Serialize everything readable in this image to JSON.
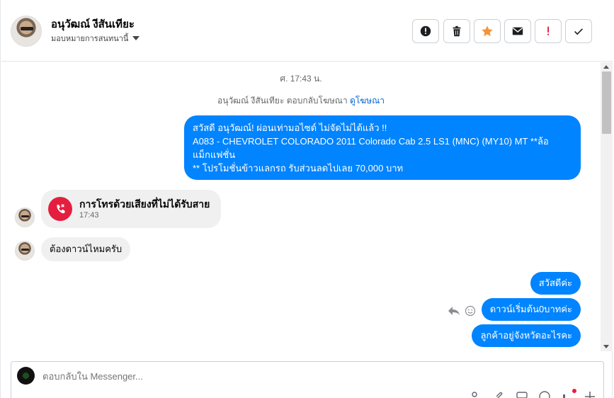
{
  "header": {
    "contact_name": "อนุวัฒณ์ งีสันเทียะ",
    "assign_label": "มอบหมายการสนทนานี้",
    "buttons": [
      {
        "name": "spam",
        "icon": "alert-circle-icon"
      },
      {
        "name": "delete",
        "icon": "trash-icon"
      },
      {
        "name": "star",
        "icon": "star-icon",
        "color": "#f7923a"
      },
      {
        "name": "mark-unread",
        "icon": "envelope-icon"
      },
      {
        "name": "important",
        "icon": "exclamation-icon",
        "color": "#e41e3f"
      },
      {
        "name": "done",
        "icon": "check-icon"
      }
    ]
  },
  "conversation": {
    "timestamp": "ศ. 17:43 น.",
    "reply_note_prefix": "อนุวัฒณ์ งีสันเทียะ ตอบกลับโฆษณา",
    "reply_note_link": "ดูโฆษณา",
    "ad_message": {
      "line1": "สวัสดี อนุวัฒณ์! ผ่อนเท่ามอไซด์ ไม่จัดไม่ได้แล้ว !!",
      "line2": "A083 - CHEVROLET COLORADO 2011 Colorado Cab 2.5 LS1 (MNC) (MY10) MT **ล้อ",
      "line3": "แม็กแฟชั่น",
      "line4": "** โปรโมชั่นข้าวแลกรถ รับส่วนลดไปเลย 70,000 บาท"
    },
    "missed_call": {
      "title": "การโทรด้วยเสียงที่ไม่ได้รับสาย",
      "time": "17:43"
    },
    "incoming_message": "ต้องดาวน์ไหมครับ",
    "outgoing_messages": [
      "สวัสดีค่ะ",
      "ดาวน์เริ่มต้น0บาทค่ะ",
      "ลูกค้าอยู่จังหวัดอะไรคะ"
    ]
  },
  "composer": {
    "placeholder": "ตอบกลับใน Messenger..."
  },
  "colors": {
    "accent": "#0084ff",
    "missed_call": "#e41e3f",
    "bubble_in": "#f0f0f0"
  }
}
